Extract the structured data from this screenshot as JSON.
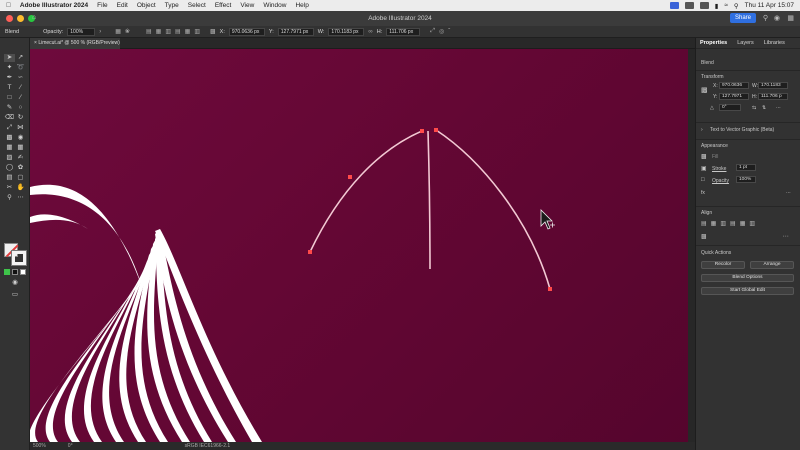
{
  "menubar": {
    "app_name": "Adobe Illustrator 2024",
    "items": [
      "File",
      "Edit",
      "Object",
      "Type",
      "Select",
      "Effect",
      "View",
      "Window",
      "Help"
    ],
    "clock": "Thu 11 Apr 15:07"
  },
  "titlebar": {
    "title": "Adobe Illustrator 2024",
    "share_label": "Share"
  },
  "controlbar": {
    "mode": "Blend",
    "opacity_label": "Opacity:",
    "opacity_value": "100%",
    "x_label": "X:",
    "x_value": "970.0636 px",
    "y_label": "Y:",
    "y_value": "127.7971 px",
    "w_label": "W:",
    "w_value": "170.1183 px",
    "h_label": "H:",
    "h_value": "111.706 px"
  },
  "document_tab": {
    "label": "Limecut.ai* @ 500 % (RGB/Preview)"
  },
  "statusbar": {
    "zoom": "500%",
    "rotate": "0°",
    "info": "sRGB IEC61966-2.1"
  },
  "panel": {
    "tabs": [
      "Properties",
      "Layers",
      "Libraries"
    ],
    "selection_type": "Blend",
    "transform_title": "Transform",
    "x_label": "X:",
    "x_value": "970.0636",
    "y_label": "Y:",
    "y_value": "127.7971",
    "w_label": "W:",
    "w_value": "170.1183",
    "h_label": "H:",
    "h_value": "111.706 p",
    "angle_value": "0°",
    "text_vector_label": "Text to Vector Graphic (Beta)",
    "appearance_title": "Appearance",
    "fill_label": "Fill",
    "stroke_label": "Stroke",
    "stroke_value": "1 pt",
    "opacity_label": "Opacity",
    "opacity_value": "100%",
    "align_title": "Align",
    "quick_actions_title": "Quick Actions",
    "btn_recolor": "Recolor",
    "btn_arrange": "Arrange",
    "btn_blend_options": "Blend Options",
    "btn_global_edit": "Start Global Edit"
  },
  "colors": {
    "canvas": "#660836",
    "path": "#f2c9d3",
    "anchor": "#ff4a4a",
    "accent": "#2f6fe0"
  }
}
